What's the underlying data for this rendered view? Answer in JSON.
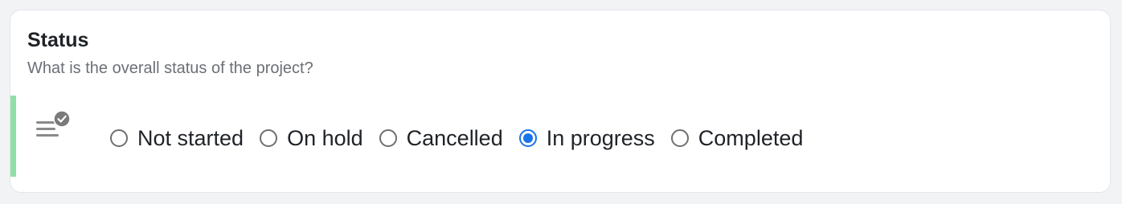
{
  "question": {
    "title": "Status",
    "description": "What is the overall status of the project?"
  },
  "field_icon": "list-check-icon",
  "colors": {
    "accent_bar": "#8fe0a8",
    "radio_selected": "#1a73e8",
    "radio_unselected": "#6f6f6f"
  },
  "options": [
    {
      "label": "Not started",
      "selected": false
    },
    {
      "label": "On hold",
      "selected": false
    },
    {
      "label": "Cancelled",
      "selected": false
    },
    {
      "label": "In progress",
      "selected": true
    },
    {
      "label": "Completed",
      "selected": false
    }
  ]
}
